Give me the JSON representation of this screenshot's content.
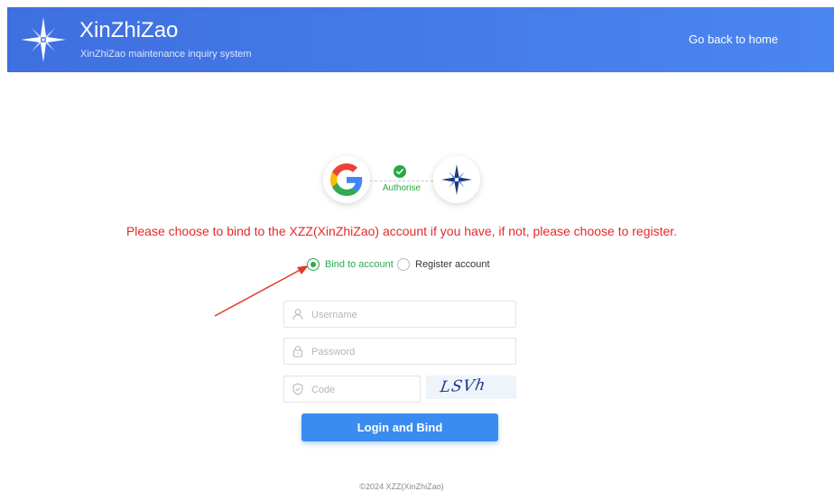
{
  "header": {
    "brand_title": "XinZhiZao",
    "brand_subtitle": "XinZhiZao maintenance inquiry system",
    "home_link": "Go back to home",
    "logo_icon": "compass-star-logo",
    "background_color": "#4a7ce8"
  },
  "auth": {
    "provider_icon": "google-icon",
    "target_icon": "xinzhizao-logo-icon",
    "status_icon": "check-icon",
    "label": "Authorise",
    "status_color": "#27a844"
  },
  "notice": {
    "text": "Please choose to bind to the XZZ(XinZhiZao) account if you have, if not, please choose to register.",
    "color": "#e12a2a"
  },
  "mode": {
    "options": [
      "Bind to account",
      "Register account"
    ],
    "selected": "Bind to account",
    "selected_color": "#2ea84e"
  },
  "form": {
    "username_placeholder": "Username",
    "password_placeholder": "Password",
    "code_placeholder": "Code",
    "captcha_text": "LSVh",
    "submit_label": "Login and Bind",
    "button_color": "#3b8cf0"
  },
  "footer": {
    "copyright": "©2024 XZZ(XinZhiZao)"
  }
}
